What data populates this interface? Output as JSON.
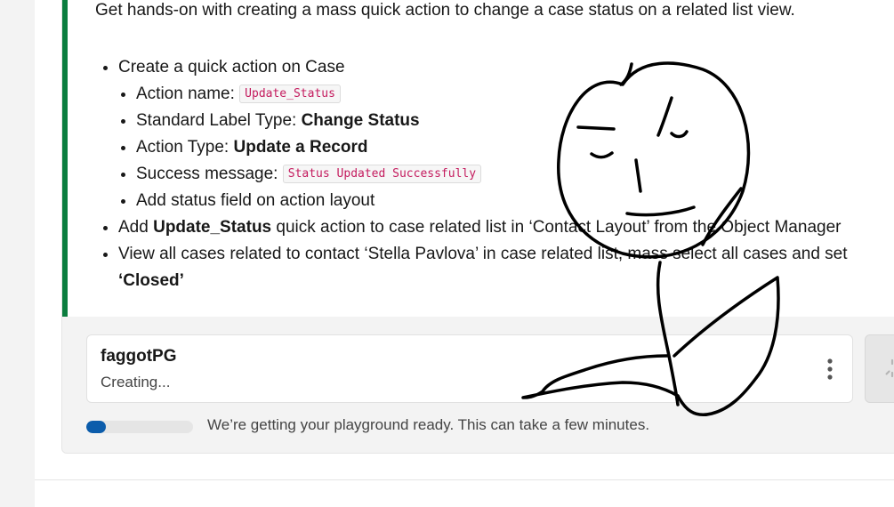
{
  "instructions": {
    "intro": "Get hands-on with creating a mass quick action to change a case status on a related list view.",
    "item1": "Create a quick action on Case",
    "sub1_label": "Action name: ",
    "sub1_code": "Update_Status",
    "sub2_label": "Standard Label Type: ",
    "sub2_bold": "Change Status",
    "sub3_label": "Action Type: ",
    "sub3_bold": "Update a Record",
    "sub4_label": "Success message: ",
    "sub4_code": "Status Updated Successfully",
    "sub5": "Add status field on action layout",
    "item2_pre": "Add ",
    "item2_bold": "Update_Status",
    "item2_post": " quick action to case related list in ‘Contact Layout’ from the Object Manager",
    "item3_line1": "View all cases related to contact ‘Stella Pavlova’ in case related list, mass select all cases and set",
    "item3_bold": "‘Closed’"
  },
  "playground": {
    "name": "faggotPG",
    "status": "Creating...",
    "progress_text": "We’re getting your playground ready. This can take a few minutes.",
    "progress_fraction": 0.18
  },
  "colors": {
    "accent_bar": "#0b7d3e",
    "progress_fill": "#0b5cab",
    "code_text": "#c41b5e"
  },
  "icons": {
    "menu": "kebab-vertical-icon",
    "loading": "spinner-icon"
  }
}
